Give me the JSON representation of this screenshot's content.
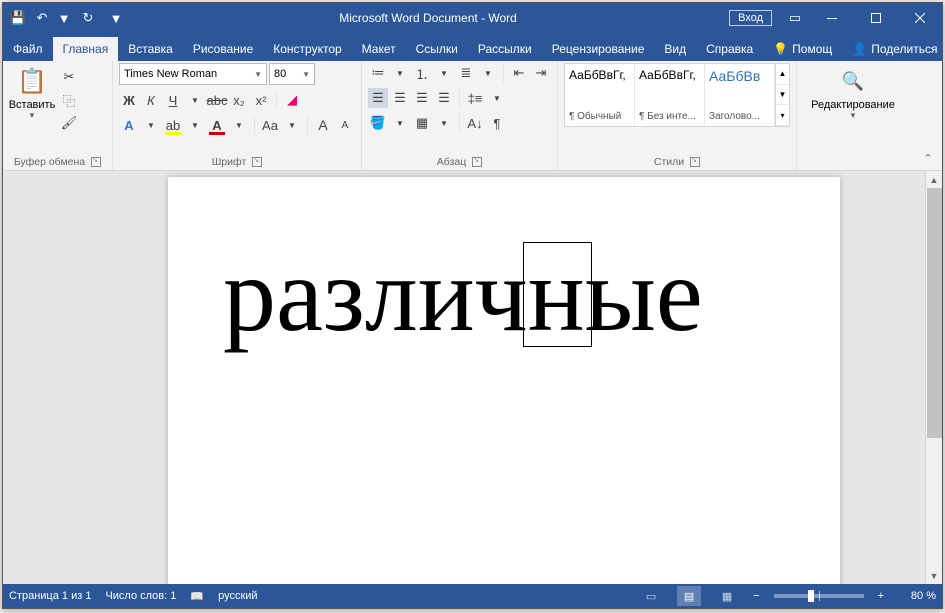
{
  "title": "Microsoft Word Document - Word",
  "login": "Вход",
  "tabs": {
    "file": "Файл",
    "home": "Главная",
    "insert": "Вставка",
    "draw": "Рисование",
    "design": "Конструктор",
    "layout": "Макет",
    "references": "Ссылки",
    "mailings": "Рассылки",
    "review": "Рецензирование",
    "view": "Вид",
    "help": "Справка",
    "tellme": "Помощ",
    "share": "Поделиться"
  },
  "ribbon": {
    "clipboard": {
      "label": "Буфер обмена",
      "paste": "Вставить"
    },
    "font": {
      "label": "Шрифт",
      "name": "Times New Roman",
      "size": "80"
    },
    "paragraph": {
      "label": "Абзац"
    },
    "styles": {
      "label": "Стили",
      "items": [
        {
          "preview": "АаБбВвГг,",
          "name": "¶ Обычный"
        },
        {
          "preview": "АаБбВвГг,",
          "name": "¶ Без инте..."
        },
        {
          "preview": "АаБбВв",
          "name": "Заголово..."
        }
      ]
    },
    "editing": {
      "label": "Редактирование"
    }
  },
  "document": {
    "text": "различные"
  },
  "statusbar": {
    "page": "Страница 1 из 1",
    "words": "Число слов: 1",
    "language": "русский",
    "zoom": "80 %"
  }
}
